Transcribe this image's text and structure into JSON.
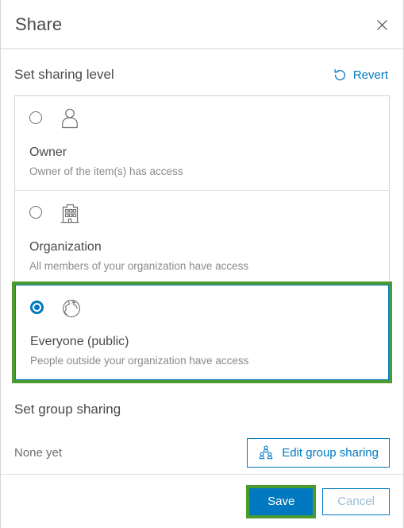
{
  "dialog": {
    "title": "Share",
    "close_icon": "close-icon"
  },
  "sharing_level": {
    "title": "Set sharing level",
    "revert_label": "Revert",
    "revert_icon": "revert-circular-arrow-icon",
    "options": [
      {
        "id": "owner",
        "label": "Owner",
        "description": "Owner of the item(s) has access",
        "icon": "person-icon",
        "selected": false
      },
      {
        "id": "organization",
        "label": "Organization",
        "description": "All members of your organization have access",
        "icon": "building-icon",
        "selected": false
      },
      {
        "id": "everyone-public",
        "label": "Everyone (public)",
        "description": "People outside your organization have access",
        "icon": "globe-icon",
        "selected": true
      }
    ]
  },
  "group_sharing": {
    "title": "Set group sharing",
    "status": "None yet",
    "edit_button_label": "Edit group sharing",
    "edit_button_icon": "group-people-icon"
  },
  "footer": {
    "save_label": "Save",
    "cancel_label": "Cancel"
  },
  "colors": {
    "accent_blue": "#0079c1",
    "highlight_green": "#4c9b2f",
    "text_primary": "#4a4a4a",
    "text_secondary": "#8a8a8a",
    "border_gray": "#d4d4d4"
  }
}
